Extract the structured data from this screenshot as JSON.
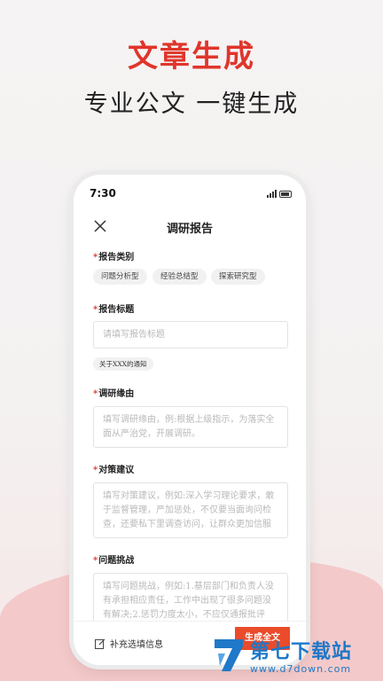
{
  "hero": {
    "title": "文章生成",
    "subtitle": "专业公文  一键生成"
  },
  "status_bar": {
    "time": "7:30"
  },
  "nav": {
    "title": "调研报告",
    "close_icon": "close-icon"
  },
  "sections": {
    "category": {
      "required": "*",
      "label": "报告类别",
      "options": [
        "问题分析型",
        "经验总结型",
        "探索研究型"
      ]
    },
    "report_title": {
      "required": "*",
      "label": "报告标题",
      "placeholder": "请填写报告标题",
      "suggestion": "关于XXX的通知"
    },
    "reason": {
      "required": "*",
      "label": "调研缘由",
      "placeholder": "填写调研缘由，例:根据上级指示，为落实全面从严治党，开展调研。"
    },
    "suggestions": {
      "required": "*",
      "label": "对策建议",
      "placeholder": "填写对策建议，例如:深入学习理论要求，敢于监督管理，严加惩处，不仅要当面询问检查，还要私下里调查访问，让群众更加信服"
    },
    "challenges": {
      "required": "*",
      "label": "问题挑战",
      "placeholder": "填写问题挑战，例如:1.基层部门和负责人没有承担相应责任，工作中出现了很多问题没有解决;2.惩罚力度太小，不应仅通报批评"
    }
  },
  "bottom_bar": {
    "more_label": "补充选填信息",
    "generate_label": "生成全文",
    "edit_icon": "edit-icon"
  },
  "watermark": {
    "brand": "第七下载站",
    "url": "www.d7down.com"
  },
  "colors": {
    "accent": "#e0352b",
    "button": "#ea4b2a",
    "watermark": "#1f78c8"
  }
}
